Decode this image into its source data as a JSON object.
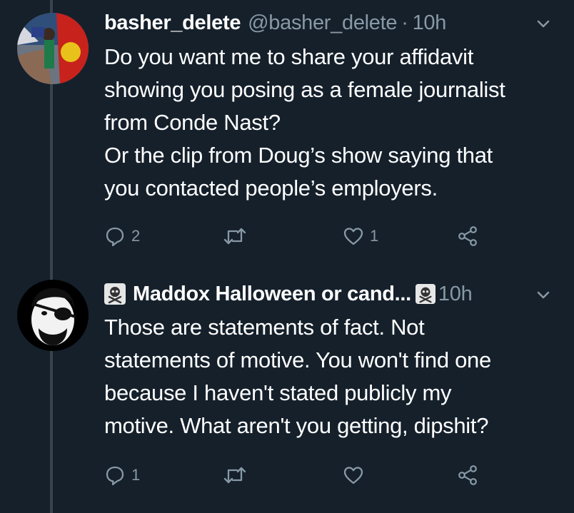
{
  "tweets": [
    {
      "name": "basher_delete",
      "handle": "@basher_delete",
      "separator": "·",
      "time": "10h",
      "text": "Do you want me to share your affidavit\nshowing you posing as a female journalist\nfrom Conde Nast?\nOr the clip from Doug’s show saying that\nyou contacted people’s employers.",
      "reply_count": "2",
      "retweet_count": "",
      "like_count": "1"
    },
    {
      "name": "Maddox Halloween or cand...",
      "time": "10h",
      "text": "Those are statements of fact. Not\nstatements of motive. You won't find one\nbecause I haven't stated publicly my\nmotive. What aren't you getting, dipshit?",
      "reply_count": "1",
      "retweet_count": "",
      "like_count": ""
    }
  ],
  "icons": {
    "reply": "reply-icon",
    "retweet": "retweet-icon",
    "like": "heart-icon",
    "share": "share-icon",
    "more": "chevron-down-icon",
    "name_emoji": "skull-crossbones-icon"
  },
  "colors": {
    "background": "#15202b",
    "text": "#ffffff",
    "secondary": "#8899a6",
    "thread_line": "#38444d"
  }
}
